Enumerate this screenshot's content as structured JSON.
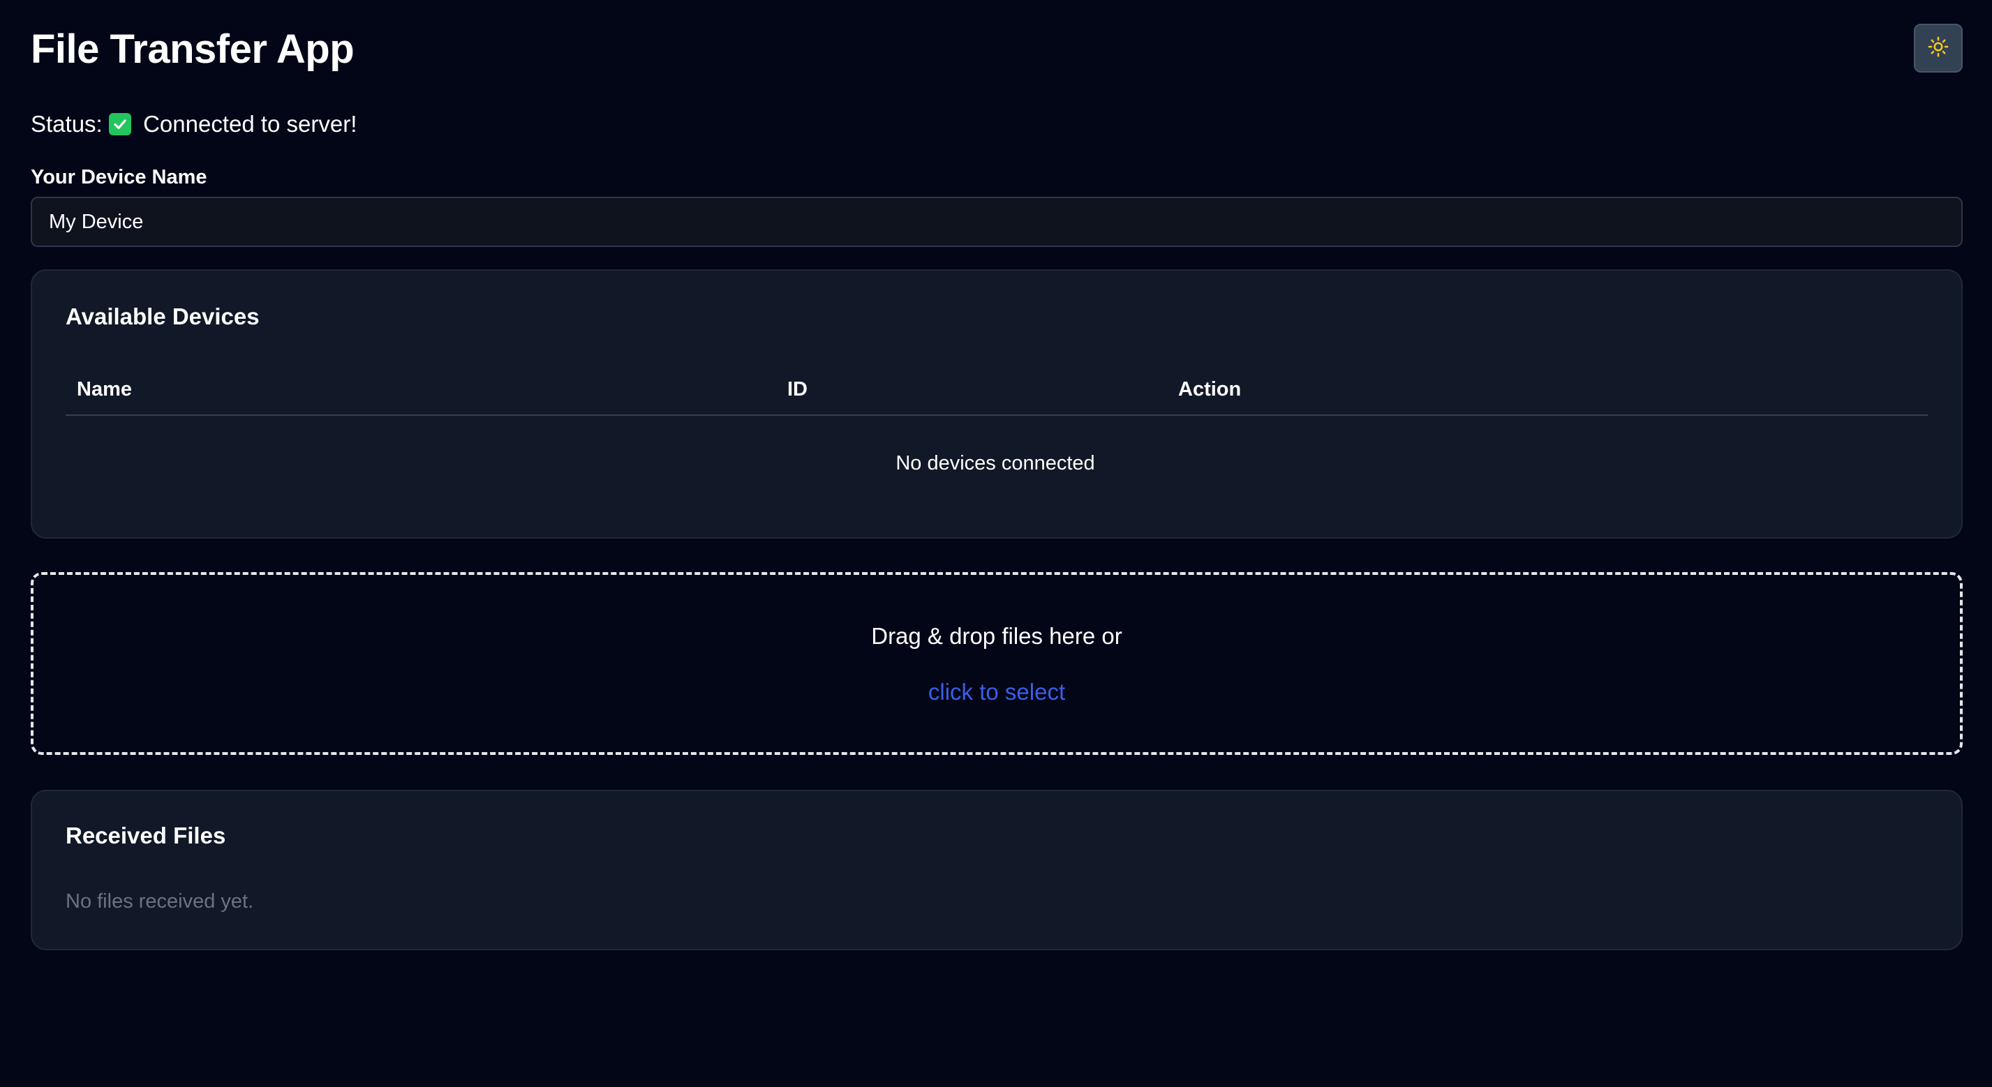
{
  "app": {
    "title": "File Transfer App"
  },
  "theme_toggle": {
    "icon": "sun-icon",
    "icon_color": "#facc15"
  },
  "status": {
    "label": "Status:",
    "icon": "check-mark-icon",
    "text": "Connected to server!"
  },
  "device_name": {
    "label": "Your Device Name",
    "value": "My Device"
  },
  "available_devices": {
    "title": "Available Devices",
    "columns": [
      "Name",
      "ID",
      "Action"
    ],
    "empty_message": "No devices connected"
  },
  "dropzone": {
    "text": "Drag & drop files here or",
    "link": "click to select",
    "link_color": "#3b5ee8"
  },
  "received_files": {
    "title": "Received Files",
    "empty_message": "No files received yet."
  },
  "colors": {
    "background": "#020617",
    "card": "#111827",
    "muted_text": "#6b7280",
    "success": "#22c55e"
  }
}
